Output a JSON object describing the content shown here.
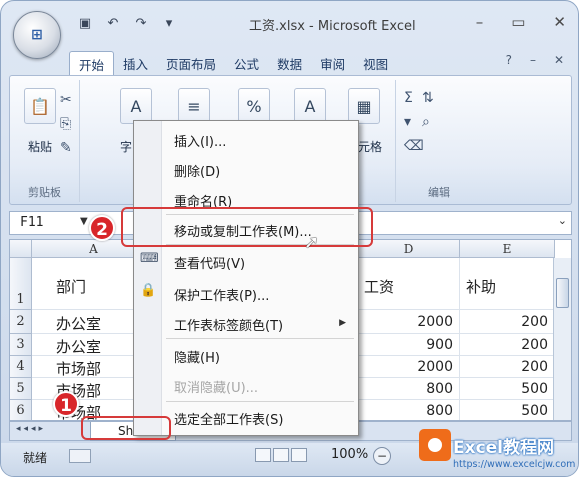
{
  "window": {
    "title": "工资.xlsx - Microsoft Excel",
    "office_button": "Office",
    "qat": [
      "save-icon",
      "undo-icon",
      "redo-icon",
      "customize-icon"
    ],
    "controls": [
      "–",
      "▭",
      "✕"
    ]
  },
  "ribbon": {
    "tabs": [
      "开始",
      "插入",
      "页面布局",
      "公式",
      "数据",
      "审阅",
      "视图"
    ],
    "right_controls": [
      "?",
      "–",
      "✕"
    ],
    "clipboard": {
      "paste_label": "粘贴",
      "group_label": "剪贴板"
    },
    "font_partial": "字",
    "cells_partial": "元格",
    "editing": {
      "sigma": "Σ",
      "group_label": "编辑"
    }
  },
  "formula_bar": {
    "name_box": "F11"
  },
  "sheet": {
    "columns": [
      "A",
      "D",
      "E"
    ],
    "rows": [
      {
        "num": "1",
        "a": "部门",
        "d": "工资",
        "e": "补助"
      },
      {
        "num": "2",
        "a": "办公室",
        "d": "2000",
        "e": "200"
      },
      {
        "num": "3",
        "a": "办公室",
        "d": "900",
        "e": "200"
      },
      {
        "num": "4",
        "a": "市场部",
        "d": "2000",
        "e": "200"
      },
      {
        "num": "5",
        "a": "市场部",
        "d": "800",
        "e": "500"
      },
      {
        "num": "6",
        "a": "市场部",
        "d": "800",
        "e": "500"
      }
    ],
    "active_tab": "Shee"
  },
  "context_menu": {
    "items": [
      {
        "label": "插入(I)...",
        "disabled": false
      },
      {
        "label": "删除(D)",
        "disabled": false
      },
      {
        "label": "重命名(R)",
        "disabled": false
      },
      {
        "label": "移动或复制工作表(M)...",
        "disabled": false
      },
      {
        "label": "查看代码(V)",
        "disabled": false
      },
      {
        "label": "保护工作表(P)...",
        "disabled": false
      },
      {
        "label": "工作表标签颜色(T)",
        "disabled": false
      },
      {
        "label": "隐藏(H)",
        "disabled": false
      },
      {
        "label": "取消隐藏(U)...",
        "disabled": true
      },
      {
        "label": "选定全部工作表(S)",
        "disabled": false
      }
    ]
  },
  "status_bar": {
    "ready": "就绪",
    "zoom": "100%"
  },
  "annotations": {
    "step1": "1",
    "step2": "2"
  },
  "watermark": {
    "brand": "Excel教程网",
    "url": "https://www.excelcjw.com"
  }
}
